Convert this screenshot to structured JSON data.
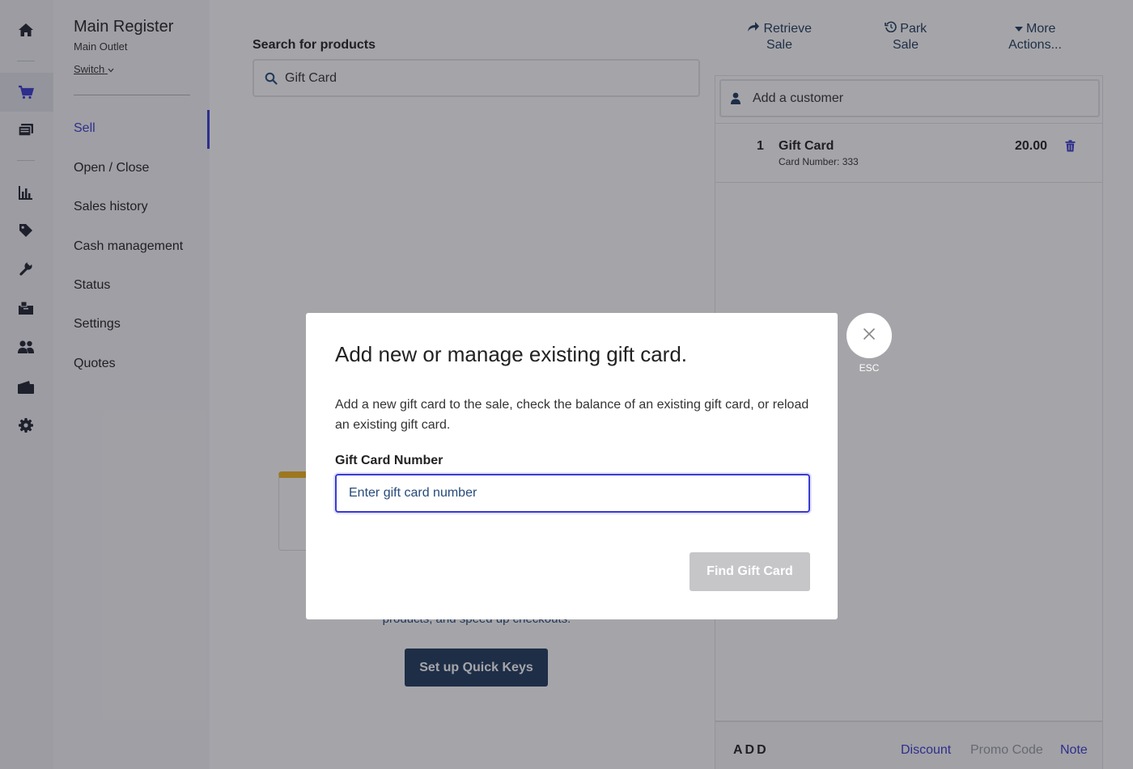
{
  "rail": {
    "icons": [
      "home-icon",
      "cart-icon",
      "catalog-icon",
      "reports-icon",
      "tag-icon",
      "wrench-icon",
      "inventory-icon",
      "customers-icon",
      "wallet-icon",
      "settings-gear-icon"
    ],
    "active": "cart-icon"
  },
  "sidebar": {
    "register_title": "Main Register",
    "outlet": "Main Outlet",
    "switch_label": "Switch",
    "items": [
      {
        "label": "Sell",
        "active": true
      },
      {
        "label": "Open / Close"
      },
      {
        "label": "Sales history"
      },
      {
        "label": "Cash management"
      },
      {
        "label": "Status"
      },
      {
        "label": "Settings"
      },
      {
        "label": "Quotes"
      }
    ]
  },
  "search": {
    "label": "Search for products",
    "value": "Gift Card"
  },
  "quick_keys": {
    "description": "products, and speed up checkouts.",
    "button_label": "Set up Quick Keys"
  },
  "top_actions": {
    "retrieve": [
      "Retrieve",
      "Sale"
    ],
    "park": [
      "Park",
      "Sale"
    ],
    "more": [
      "More",
      "Actions..."
    ]
  },
  "sale": {
    "customer_placeholder": "Add a customer",
    "line_items": [
      {
        "qty": "1",
        "name": "Gift Card",
        "sub": "Card Number: 333",
        "price": "20.00"
      }
    ],
    "bottom_bar": {
      "add_label": "ADD",
      "discount_label": "Discount",
      "promo_label": "Promo Code",
      "note_label": "Note"
    }
  },
  "modal": {
    "title": "Add new or manage existing gift card.",
    "description": "Add a new gift card to the sale, check the balance of an existing gift card, or reload an existing gift card.",
    "field_label": "Gift Card Number",
    "field_placeholder": "Enter gift card number",
    "field_value": "",
    "submit_label": "Find Gift Card",
    "close_hint": "ESC"
  },
  "colors": {
    "accent": "#3a3ad1",
    "navy": "#1f3a5c",
    "disabled_button": "#c6c6c9",
    "quick_key_stripe": "#f2b21b"
  }
}
